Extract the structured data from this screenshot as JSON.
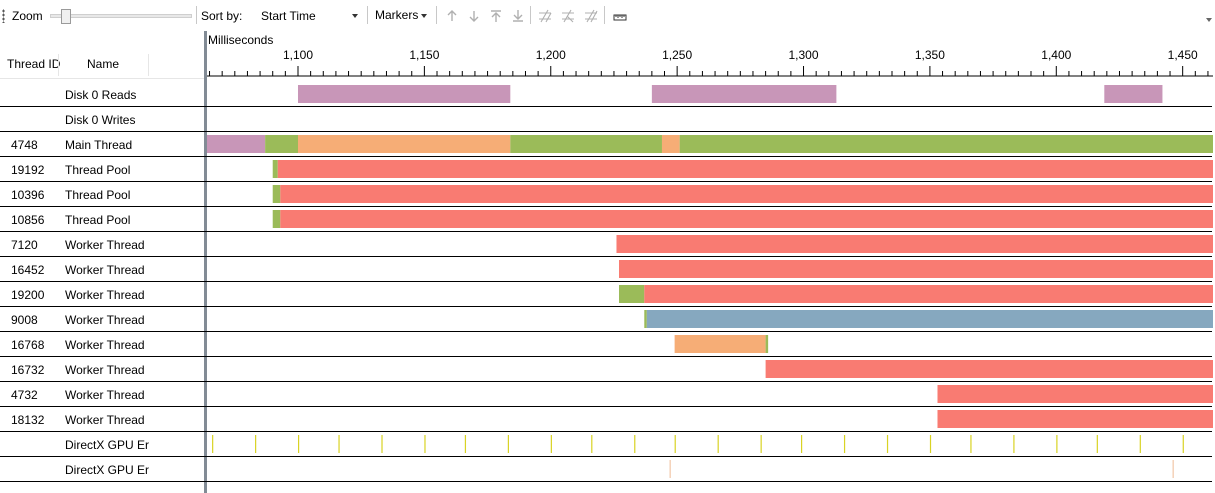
{
  "toolbar": {
    "zoom_label": "Zoom",
    "zoom_level": 0.1,
    "sort_label": "Sort by:",
    "sort_value": "Start Time",
    "markers_label": "Markers",
    "icons": [
      "arrow-up-icon",
      "arrow-down-icon",
      "arrow-to-top-icon",
      "arrow-to-bottom-icon",
      "add-marker-icon",
      "remove-marker-icon",
      "clear-markers-icon",
      "ruler-icon"
    ]
  },
  "columns": {
    "thread_id": "Thread ID",
    "name": "Name"
  },
  "timeline": {
    "unit_label": "Milliseconds",
    "axis": {
      "min": 1064,
      "max": 1462
    },
    "ticks": [
      {
        "value": 1100,
        "label": "1,100"
      },
      {
        "value": 1150,
        "label": "1,150"
      },
      {
        "value": 1200,
        "label": "1,200"
      },
      {
        "value": 1250,
        "label": "1,250"
      },
      {
        "value": 1300,
        "label": "1,300"
      },
      {
        "value": 1350,
        "label": "1,350"
      },
      {
        "value": 1400,
        "label": "1,400"
      },
      {
        "value": 1450,
        "label": "1,450"
      }
    ]
  },
  "colors": {
    "disk": "#c896b8",
    "cpu": "#9bbb59",
    "io": "#f6ad76",
    "sync": "#f97b72",
    "sleep": "#86a8bf",
    "gpu_event": "#d9d324",
    "gpu_event_light": "#f2c7a6"
  },
  "threads": [
    {
      "id": "",
      "name": "Disk 0 Reads",
      "segments": [
        {
          "start": 1100,
          "end": 1184,
          "state": "disk"
        },
        {
          "start": 1240,
          "end": 1313,
          "state": "disk"
        },
        {
          "start": 1419,
          "end": 1442,
          "state": "disk"
        }
      ]
    },
    {
      "id": "",
      "name": "Disk 0 Writes",
      "segments": []
    },
    {
      "id": "4748",
      "name": "Main Thread",
      "segments": [
        {
          "start": 1064,
          "end": 1087,
          "state": "disk"
        },
        {
          "start": 1087,
          "end": 1100,
          "state": "cpu"
        },
        {
          "start": 1100,
          "end": 1184,
          "state": "io"
        },
        {
          "start": 1184,
          "end": 1244,
          "state": "cpu"
        },
        {
          "start": 1244,
          "end": 1251,
          "state": "io"
        },
        {
          "start": 1251,
          "end": 1466,
          "state": "cpu"
        }
      ]
    },
    {
      "id": "19192",
      "name": "Thread Pool",
      "segments": [
        {
          "start": 1090,
          "end": 1092,
          "state": "cpu"
        },
        {
          "start": 1092,
          "end": 1464,
          "state": "sync"
        }
      ]
    },
    {
      "id": "10396",
      "name": "Thread Pool",
      "segments": [
        {
          "start": 1090,
          "end": 1093,
          "state": "cpu"
        },
        {
          "start": 1093,
          "end": 1464,
          "state": "sync"
        }
      ]
    },
    {
      "id": "10856",
      "name": "Thread Pool",
      "segments": [
        {
          "start": 1090,
          "end": 1093,
          "state": "cpu"
        },
        {
          "start": 1093,
          "end": 1464,
          "state": "sync"
        }
      ]
    },
    {
      "id": "7120",
      "name": "Worker Thread",
      "segments": [
        {
          "start": 1226,
          "end": 1464,
          "state": "sync"
        }
      ]
    },
    {
      "id": "16452",
      "name": "Worker Thread",
      "segments": [
        {
          "start": 1227,
          "end": 1464,
          "state": "sync"
        }
      ]
    },
    {
      "id": "19200",
      "name": "Worker Thread",
      "segments": [
        {
          "start": 1227,
          "end": 1237,
          "state": "cpu"
        },
        {
          "start": 1237,
          "end": 1463,
          "state": "sync"
        },
        {
          "start": 1463,
          "end": 1464,
          "state": "cpu"
        }
      ]
    },
    {
      "id": "9008",
      "name": "Worker Thread",
      "segments": [
        {
          "start": 1237,
          "end": 1238,
          "state": "cpu"
        },
        {
          "start": 1238,
          "end": 1463,
          "state": "sleep"
        },
        {
          "start": 1463,
          "end": 1464,
          "state": "cpu"
        }
      ]
    },
    {
      "id": "16768",
      "name": "Worker Thread",
      "segments": [
        {
          "start": 1249,
          "end": 1285,
          "state": "io"
        },
        {
          "start": 1285,
          "end": 1286,
          "state": "cpu"
        }
      ]
    },
    {
      "id": "16732",
      "name": "Worker Thread",
      "segments": [
        {
          "start": 1285,
          "end": 1464,
          "state": "sync"
        }
      ]
    },
    {
      "id": "4732",
      "name": "Worker Thread",
      "segments": [
        {
          "start": 1353,
          "end": 1464,
          "state": "sync"
        }
      ]
    },
    {
      "id": "18132",
      "name": "Worker Thread",
      "segments": [
        {
          "start": 1353,
          "end": 1464,
          "state": "sync"
        }
      ]
    },
    {
      "id": "",
      "name": "DirectX GPU Er",
      "events": [
        1066,
        1083,
        1100,
        1116,
        1133,
        1150,
        1166,
        1183,
        1200,
        1216,
        1233,
        1249,
        1266,
        1283,
        1299,
        1316,
        1333,
        1350,
        1366,
        1383,
        1400,
        1416,
        1433,
        1450
      ],
      "event_state": "gpu_event"
    },
    {
      "id": "",
      "name": "DirectX GPU Er",
      "events": [
        1247,
        1446
      ],
      "event_state": "gpu_event_light"
    }
  ]
}
